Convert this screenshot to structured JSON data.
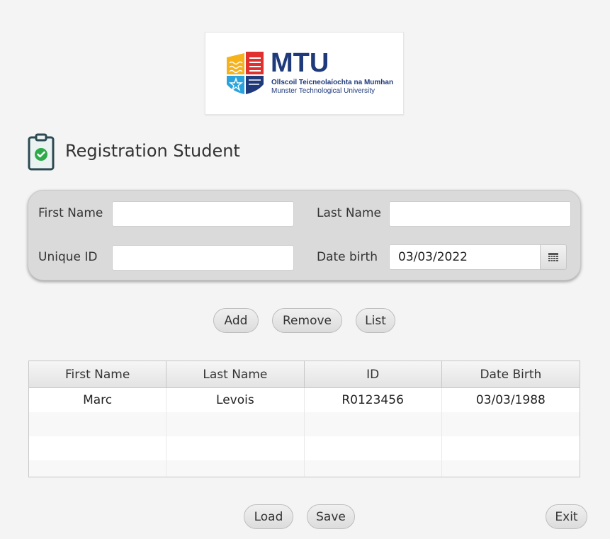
{
  "logo": {
    "name": "MTU",
    "line1": "Ollscoil Teicneolaíochta na Mumhan",
    "line2": "Munster Technological University",
    "colors": {
      "navy": "#1f3a7a",
      "yellow": "#f5b21b",
      "red": "#e0312f",
      "blue": "#29a3dd"
    }
  },
  "header": {
    "title": "Registration Student",
    "icon": "clipboard-check-icon"
  },
  "form": {
    "first_name_label": "First Name",
    "first_name_value": "",
    "last_name_label": "Last Name",
    "last_name_value": "",
    "unique_id_label": "Unique ID",
    "unique_id_value": "",
    "date_birth_label": "Date birth",
    "date_birth_value": "03/03/2022",
    "calendar_icon": "calendar-icon"
  },
  "actions": {
    "add": "Add",
    "remove": "Remove",
    "list": "List"
  },
  "table": {
    "columns": [
      "First Name",
      "Last Name",
      "ID",
      "Date Birth"
    ],
    "rows": [
      [
        "Marc",
        "Levois",
        "R0123456",
        "03/03/1988"
      ],
      [
        "",
        "",
        "",
        ""
      ],
      [
        "",
        "",
        "",
        ""
      ],
      [
        "",
        "",
        "",
        ""
      ]
    ]
  },
  "footer": {
    "load": "Load",
    "save": "Save",
    "exit": "Exit"
  },
  "colors": {
    "background": "#f4f4f4",
    "panel": "#dadada",
    "accent_green": "#2eaa4a",
    "icon_dark": "#2c4a52"
  }
}
